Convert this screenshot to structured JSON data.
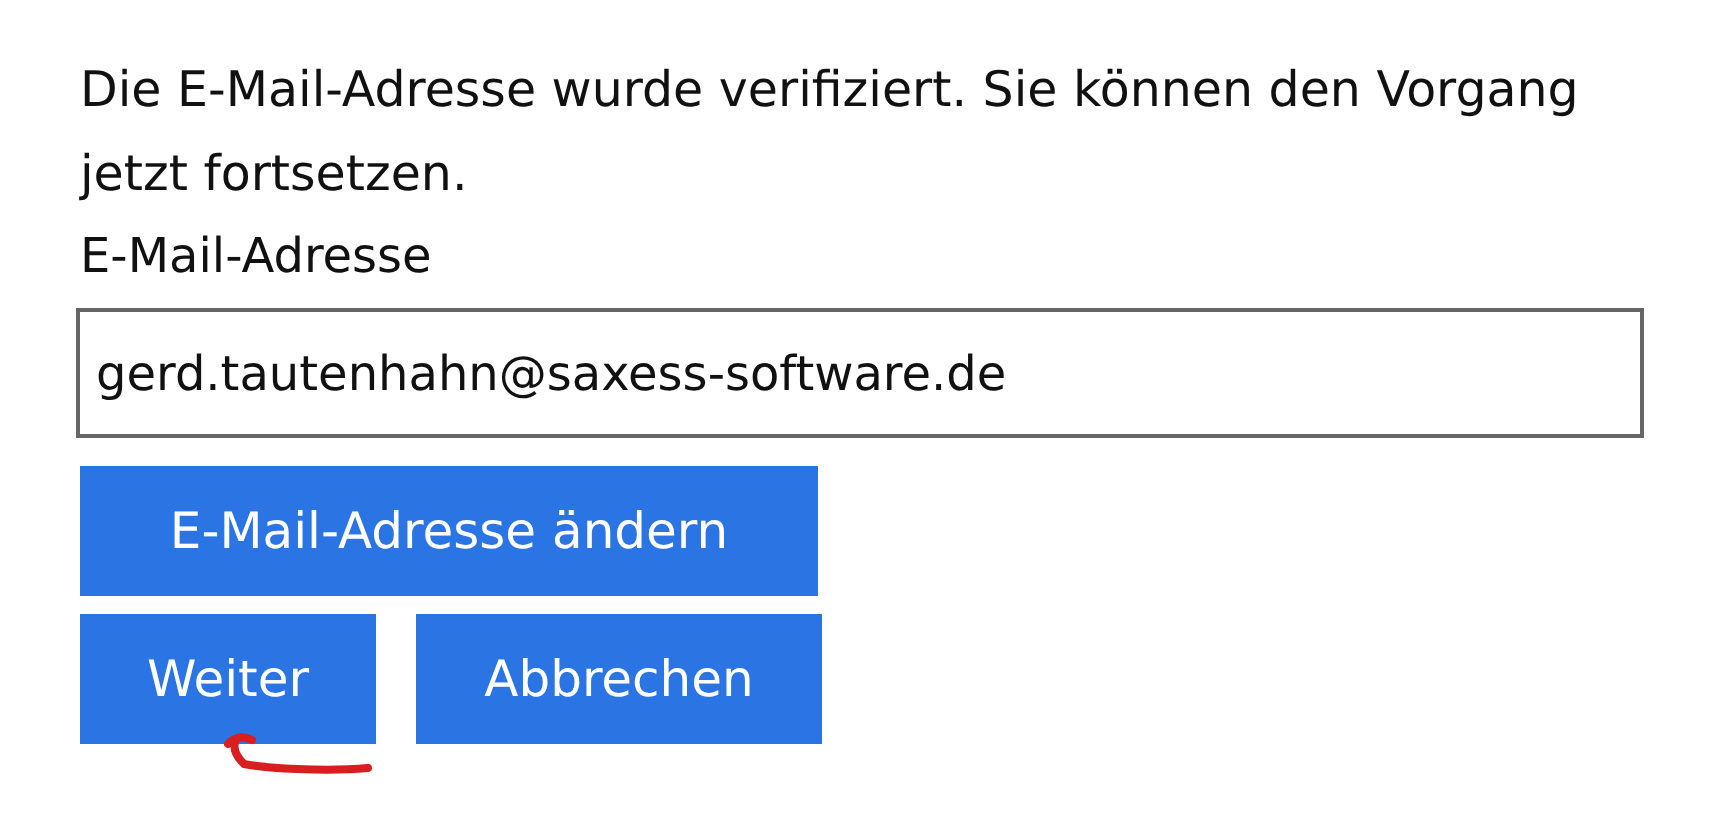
{
  "message": "Die E-Mail-Adresse wurde verifiziert. Sie können den Vorgang jetzt fortsetzen.",
  "email_field": {
    "label": "E-Mail-Adresse",
    "value": "gerd.tautenhahn@saxess-software.de"
  },
  "change_button": "E-Mail-Adresse ändern",
  "buttons": [
    "Weiter",
    "Abbrechen"
  ],
  "annotation": {
    "kind": "arrow",
    "color": "#d81e1e"
  }
}
